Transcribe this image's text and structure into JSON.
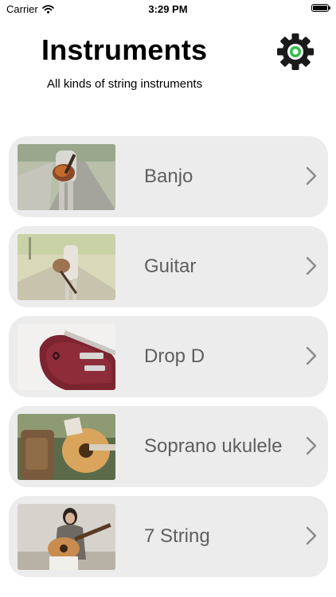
{
  "status_bar": {
    "carrier": "Carrier",
    "time": "3:29 PM"
  },
  "header": {
    "title": "Instruments",
    "subtitle": "All kinds of string instruments",
    "settings_icon": "gear-icon",
    "accent_color": "#2ebd4a"
  },
  "instruments": [
    {
      "label": "Banjo",
      "photo": "person-holding-guitar-on-road"
    },
    {
      "label": "Guitar",
      "photo": "person-with-guitar-on-path"
    },
    {
      "label": "Drop D",
      "photo": "red-electric-guitar"
    },
    {
      "label": "Soprano ukulele",
      "photo": "ukulele-with-bag"
    },
    {
      "label": "7 String",
      "photo": "woman-playing-acoustic-guitar"
    }
  ],
  "row_icon": "chevron-right-icon",
  "colors": {
    "row_background": "#ececec",
    "row_text": "#5f5f5f",
    "chevron": "#8a8a8a"
  }
}
